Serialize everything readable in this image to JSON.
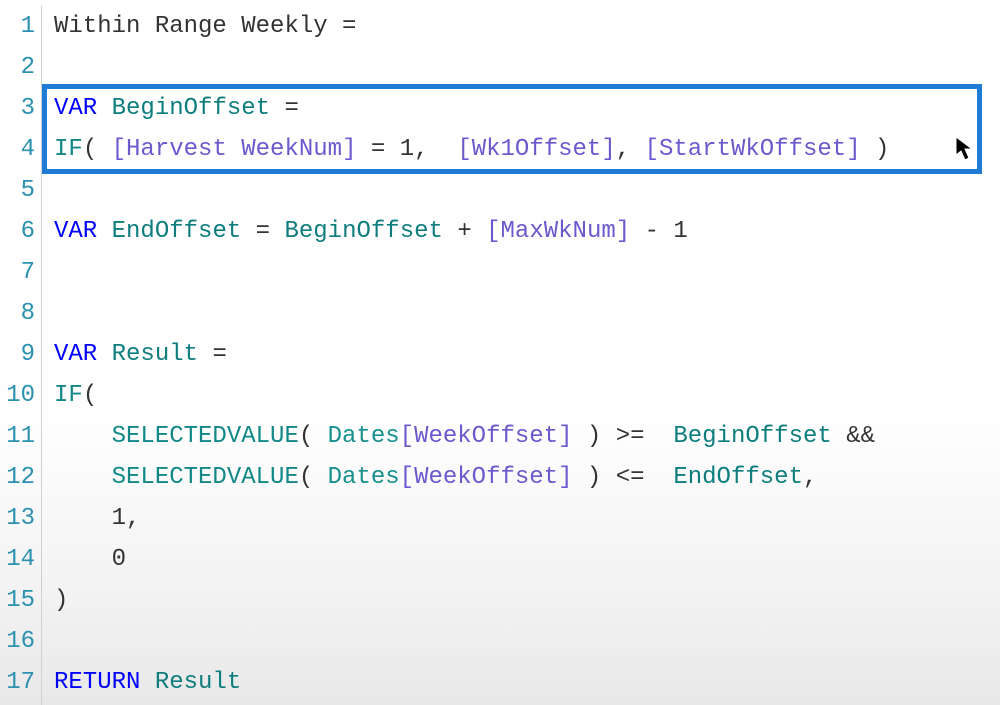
{
  "colors": {
    "highlight_border": "#1f7cd6",
    "keyword": "#0000ff",
    "function": "#118888",
    "variable": "#0d7d7d",
    "measure": "#6a5acd",
    "table": "#168f8f",
    "plain": "#333333",
    "line_number": "#2b91af"
  },
  "gutter": {
    "line_numbers": [
      "1",
      "2",
      "3",
      "4",
      "5",
      "6",
      "7",
      "8",
      "9",
      "10",
      "11",
      "12",
      "13",
      "14",
      "15",
      "16",
      "17"
    ]
  },
  "code": {
    "lines": [
      {
        "n": 1,
        "tokens": [
          {
            "t": "plain",
            "v": "Within Range Weekly "
          },
          {
            "t": "op",
            "v": "="
          }
        ]
      },
      {
        "n": 2,
        "tokens": []
      },
      {
        "n": 3,
        "tokens": [
          {
            "t": "kw",
            "v": "VAR"
          },
          {
            "t": "plain",
            "v": " "
          },
          {
            "t": "var",
            "v": "BeginOffset"
          },
          {
            "t": "plain",
            "v": " "
          },
          {
            "t": "op",
            "v": "="
          }
        ]
      },
      {
        "n": 4,
        "tokens": [
          {
            "t": "fn",
            "v": "IF"
          },
          {
            "t": "op",
            "v": "("
          },
          {
            "t": "plain",
            "v": " "
          },
          {
            "t": "mea",
            "v": "[Harvest WeekNum]"
          },
          {
            "t": "plain",
            "v": " "
          },
          {
            "t": "op",
            "v": "="
          },
          {
            "t": "plain",
            "v": " "
          },
          {
            "t": "num",
            "v": "1"
          },
          {
            "t": "op",
            "v": ","
          },
          {
            "t": "plain",
            "v": "  "
          },
          {
            "t": "mea",
            "v": "[Wk1Offset]"
          },
          {
            "t": "op",
            "v": ","
          },
          {
            "t": "plain",
            "v": " "
          },
          {
            "t": "mea",
            "v": "[StartWkOffset]"
          },
          {
            "t": "plain",
            "v": " "
          },
          {
            "t": "op",
            "v": ")"
          }
        ]
      },
      {
        "n": 5,
        "tokens": []
      },
      {
        "n": 6,
        "tokens": [
          {
            "t": "kw",
            "v": "VAR"
          },
          {
            "t": "plain",
            "v": " "
          },
          {
            "t": "var",
            "v": "EndOffset"
          },
          {
            "t": "plain",
            "v": " "
          },
          {
            "t": "op",
            "v": "="
          },
          {
            "t": "plain",
            "v": " "
          },
          {
            "t": "var",
            "v": "BeginOffset"
          },
          {
            "t": "plain",
            "v": " "
          },
          {
            "t": "op",
            "v": "+"
          },
          {
            "t": "plain",
            "v": " "
          },
          {
            "t": "mea",
            "v": "[MaxWkNum]"
          },
          {
            "t": "plain",
            "v": " "
          },
          {
            "t": "op",
            "v": "-"
          },
          {
            "t": "plain",
            "v": " "
          },
          {
            "t": "num",
            "v": "1"
          }
        ]
      },
      {
        "n": 7,
        "tokens": []
      },
      {
        "n": 8,
        "tokens": []
      },
      {
        "n": 9,
        "tokens": [
          {
            "t": "kw",
            "v": "VAR"
          },
          {
            "t": "plain",
            "v": " "
          },
          {
            "t": "var",
            "v": "Result"
          },
          {
            "t": "plain",
            "v": " "
          },
          {
            "t": "op",
            "v": "="
          }
        ]
      },
      {
        "n": 10,
        "tokens": [
          {
            "t": "fn",
            "v": "IF"
          },
          {
            "t": "op",
            "v": "("
          }
        ]
      },
      {
        "n": 11,
        "tokens": [
          {
            "t": "plain",
            "v": "    "
          },
          {
            "t": "fn",
            "v": "SELECTEDVALUE"
          },
          {
            "t": "op",
            "v": "("
          },
          {
            "t": "plain",
            "v": " "
          },
          {
            "t": "tbl",
            "v": "Dates"
          },
          {
            "t": "mea",
            "v": "[WeekOffset]"
          },
          {
            "t": "plain",
            "v": " "
          },
          {
            "t": "op",
            "v": ")"
          },
          {
            "t": "plain",
            "v": " "
          },
          {
            "t": "op",
            "v": ">="
          },
          {
            "t": "plain",
            "v": "  "
          },
          {
            "t": "var",
            "v": "BeginOffset"
          },
          {
            "t": "plain",
            "v": " "
          },
          {
            "t": "op",
            "v": "&&"
          }
        ]
      },
      {
        "n": 12,
        "tokens": [
          {
            "t": "plain",
            "v": "    "
          },
          {
            "t": "fn",
            "v": "SELECTEDVALUE"
          },
          {
            "t": "op",
            "v": "("
          },
          {
            "t": "plain",
            "v": " "
          },
          {
            "t": "tbl",
            "v": "Dates"
          },
          {
            "t": "mea",
            "v": "[WeekOffset]"
          },
          {
            "t": "plain",
            "v": " "
          },
          {
            "t": "op",
            "v": ")"
          },
          {
            "t": "plain",
            "v": " "
          },
          {
            "t": "op",
            "v": "<="
          },
          {
            "t": "plain",
            "v": "  "
          },
          {
            "t": "var",
            "v": "EndOffset"
          },
          {
            "t": "op",
            "v": ","
          }
        ]
      },
      {
        "n": 13,
        "tokens": [
          {
            "t": "plain",
            "v": "    "
          },
          {
            "t": "num",
            "v": "1"
          },
          {
            "t": "op",
            "v": ","
          }
        ]
      },
      {
        "n": 14,
        "tokens": [
          {
            "t": "plain",
            "v": "    "
          },
          {
            "t": "num",
            "v": "0"
          }
        ]
      },
      {
        "n": 15,
        "tokens": [
          {
            "t": "op",
            "v": ")"
          }
        ]
      },
      {
        "n": 16,
        "tokens": []
      },
      {
        "n": 17,
        "tokens": [
          {
            "t": "kw",
            "v": "RETURN"
          },
          {
            "t": "plain",
            "v": " "
          },
          {
            "t": "var",
            "v": "Result"
          }
        ]
      }
    ]
  },
  "highlight": {
    "from_line": 3,
    "to_line": 4
  },
  "cursor": "arrow"
}
